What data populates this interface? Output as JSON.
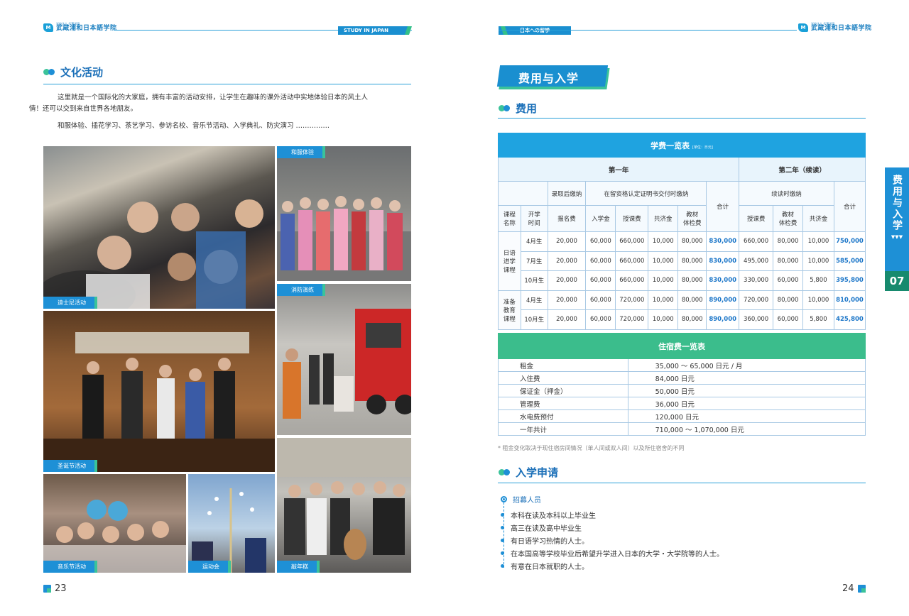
{
  "left_page": {
    "logo": {
      "small": "学校法人 千葉学園",
      "name": "武蔵浦和日本語学院"
    },
    "header_badge": "STUDY IN JAPAN",
    "section_title": "文化活动",
    "intro_line1": "这里就是一个国际化的大家庭，拥有丰富的活动安排，让学生在趣味的课外活动中实地体验日本的风土人",
    "intro_line2": "情！还可以交到来自世界各地朋友。",
    "activities": "和服体验、插花学习、茶艺学习、参访名校、音乐节活动、入学典礼、防灾演习 ……………",
    "photos": {
      "disney": "迪士尼活动",
      "kimono": "和服体验",
      "fire_drill": "消防演练",
      "christmas": "圣诞节活动",
      "music": "音乐节活动",
      "sports": "运动会",
      "mochi": "敲年糕"
    },
    "page_number": "23"
  },
  "right_page": {
    "header_badge": "日本への留学",
    "logo": {
      "small": "学校法人 千葉学園",
      "name": "武蔵浦和日本語学院"
    },
    "banner": "费用与入学",
    "side_tab": {
      "text": "费用与入学",
      "arrow": "▼▼▼",
      "number": "07"
    },
    "fee_section_title": "费用",
    "fee_table": {
      "title": "学费一览表",
      "unit": "[单位：日元]",
      "year1": "第一年",
      "year2": "第二年（续读）",
      "on_admission": "录取后缴纳",
      "on_coe": "在留资格认定证明书交付时缴纳",
      "subtotal": "合计",
      "continue_pay": "续读时缴纳",
      "subtotal2": "合计",
      "col_course": "课程\n名称",
      "col_term": "开学\n时间",
      "col_reg": "报名费",
      "col_adm": "入学金",
      "col_tuition": "授课费",
      "col_fund": "共济金",
      "col_books": "教材\n体检费",
      "col_tuition2": "授课费",
      "col_books2": "教材\n体检费",
      "col_fund2": "共济金",
      "groups": [
        {
          "name": "日语\n进学\n课程",
          "rows": [
            {
              "term": "4月生",
              "reg": "20,000",
              "adm": "60,000",
              "tuition": "660,000",
              "fund": "10,000",
              "books": "80,000",
              "total1": "830,000",
              "tuition2": "660,000",
              "books2": "80,000",
              "fund2": "10,000",
              "total2": "750,000"
            },
            {
              "term": "7月生",
              "reg": "20,000",
              "adm": "60,000",
              "tuition": "660,000",
              "fund": "10,000",
              "books": "80,000",
              "total1": "830,000",
              "tuition2": "495,000",
              "books2": "80,000",
              "fund2": "10,000",
              "total2": "585,000"
            },
            {
              "term": "10月生",
              "reg": "20,000",
              "adm": "60,000",
              "tuition": "660,000",
              "fund": "10,000",
              "books": "80,000",
              "total1": "830,000",
              "tuition2": "330,000",
              "books2": "60,000",
              "fund2": "5,800",
              "total2": "395,800"
            }
          ]
        },
        {
          "name": "准备\n教育\n课程",
          "rows": [
            {
              "term": "4月生",
              "reg": "20,000",
              "adm": "60,000",
              "tuition": "720,000",
              "fund": "10,000",
              "books": "80,000",
              "total1": "890,000",
              "tuition2": "720,000",
              "books2": "80,000",
              "fund2": "10,000",
              "total2": "810,000"
            },
            {
              "term": "10月生",
              "reg": "20,000",
              "adm": "60,000",
              "tuition": "720,000",
              "fund": "10,000",
              "books": "80,000",
              "total1": "890,000",
              "tuition2": "360,000",
              "books2": "60,000",
              "fund2": "5,800",
              "total2": "425,800"
            }
          ]
        }
      ]
    },
    "rent_table": {
      "title": "住宿费一览表",
      "rows": [
        {
          "label": "租金",
          "value": "35,000 ～ 65,000 日元 / 月"
        },
        {
          "label": "入住费",
          "value": "84,000 日元"
        },
        {
          "label": "保证金（押金）",
          "value": "50,000 日元"
        },
        {
          "label": "管理费",
          "value": "36,000 日元"
        },
        {
          "label": "水电费预付",
          "value": "120,000 日元"
        },
        {
          "label": "一年共计",
          "value": "710,000 ～ 1,070,000 日元"
        }
      ]
    },
    "note": "* 租金变化取决于现住宿房间情况（单人间或双人间）以及所住宿舍的不同",
    "admission_section_title": "入学申请",
    "recruit_title": "招募人员",
    "recruit_items": [
      "本科在读及本科以上毕业生",
      "高三在读及高中毕业生",
      "有日语学习热情的人士。",
      "在本国高等学校毕业后希望升学进入日本的大学・大学院等的人士。",
      "有意在日本就职的人士。"
    ],
    "page_number": "24"
  }
}
